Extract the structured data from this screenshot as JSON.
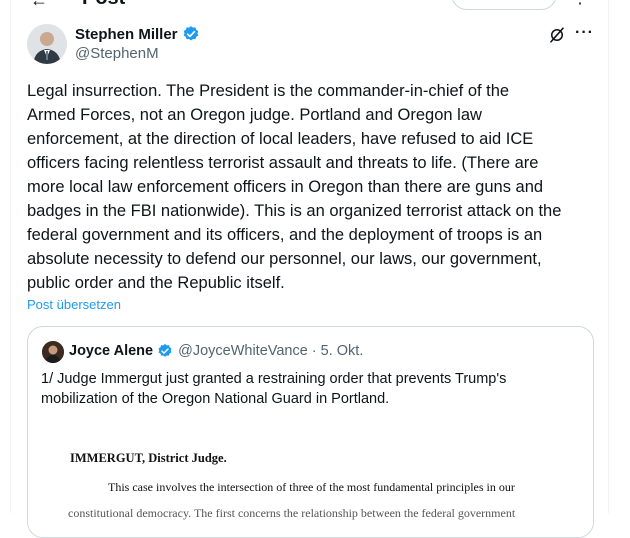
{
  "header": {
    "back_glyph": "←",
    "title": "Post",
    "more_glyph": "⋮"
  },
  "post": {
    "author_name": "Stephen Miller",
    "author_handle": "@StephenM",
    "verified_color": "#1d9bf0",
    "icons": [
      "grok-icon",
      "more-dots-icon"
    ],
    "more_glyph": "···",
    "text": "Legal insurrection. The President is the commander-in-chief of the\nArmed Forces, not an Oregon judge. Portland and Oregon law\nenforcement, at the direction of local leaders, have refused to aid ICE\nofficers facing relentless terrorist assault and threats to life. (There are\nmore local law enforcement officers in Oregon than there are guns and\nbadges in the FBI nationwide). This is an organized terrorist attack on the\nfederal government and its officers, and the deployment of troops is an\nabsolute necessity to defend our personnel, our laws, our government,\npublic order and the Republic itself.",
    "translate_label": "Post übersetzen"
  },
  "quote": {
    "author_name": "Joyce Alene",
    "author_handle": "@JoyceWhiteVance",
    "separator": "·",
    "date": "5. Okt.",
    "text": "1/ Judge Immergut just granted a restraining order that prevents Trump's mobilization of the Oregon National Guard in Portland.",
    "document": {
      "judge_line": "IMMERGUT, District Judge.",
      "line1": "This case involves the intersection of three of the most fundamental principles in our",
      "line2": "constitutional democracy. The first concerns the relationship between the federal government"
    }
  },
  "colors": {
    "accent": "#1d9bf0",
    "text": "#0f1419",
    "secondary": "#536471",
    "border": "#cfd9de"
  }
}
